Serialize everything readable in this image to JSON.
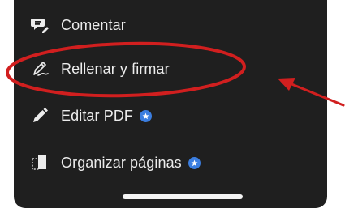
{
  "menu": {
    "items": [
      {
        "label": "Comentar",
        "icon": "comment-pen-icon",
        "premium": false
      },
      {
        "label": "Rellenar y firmar",
        "icon": "signature-pen-icon",
        "premium": false
      },
      {
        "label": "Editar PDF",
        "icon": "pencil-icon",
        "premium": true
      },
      {
        "label": "Organizar páginas",
        "icon": "organize-pages-icon",
        "premium": true
      }
    ]
  },
  "annotation": {
    "highlighted_item": "Rellenar y firmar",
    "color": "#d11f1f"
  },
  "colors": {
    "panel_background": "#1f1f1f",
    "text": "#ececec",
    "premium_badge": "#3b7ee0"
  }
}
